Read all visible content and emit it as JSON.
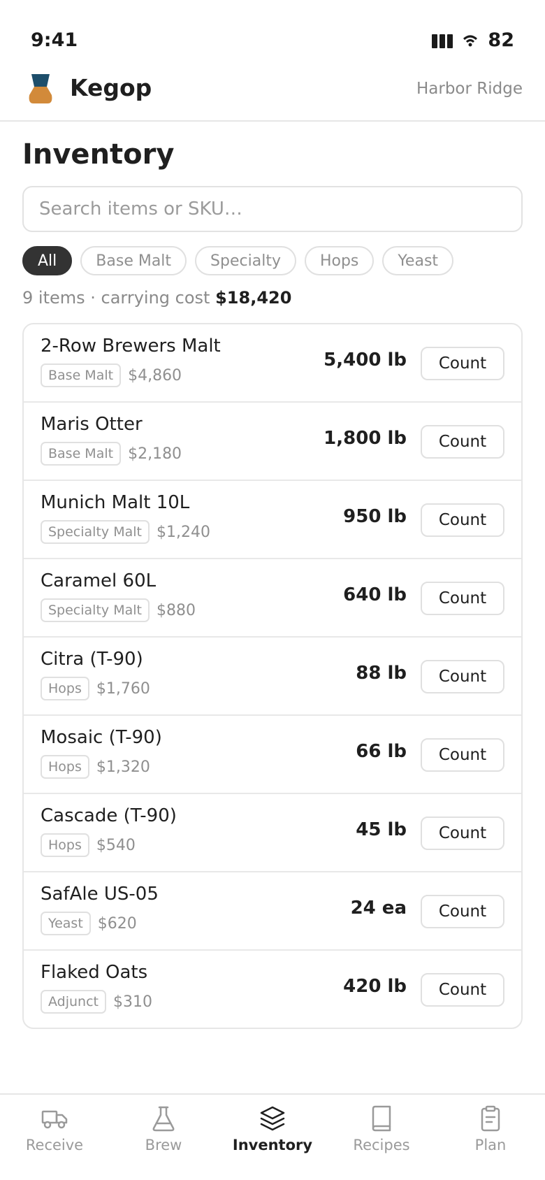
{
  "status_bar": {
    "time": "9:41",
    "battery": "82"
  },
  "header": {
    "app_name": "Kegop",
    "location": "Harbor Ridge"
  },
  "page": {
    "title": "Inventory"
  },
  "search": {
    "placeholder": "Search items or SKU…",
    "value": ""
  },
  "filters": [
    {
      "label": "All",
      "active": true
    },
    {
      "label": "Base Malt",
      "active": false
    },
    {
      "label": "Specialty",
      "active": false
    },
    {
      "label": "Hops",
      "active": false
    },
    {
      "label": "Yeast",
      "active": false
    }
  ],
  "summary": {
    "prefix": "9 items · carrying cost",
    "total": "$18,420"
  },
  "items": [
    {
      "name": "2-Row Brewers Malt",
      "category": "Base Malt",
      "cost": "$4,860",
      "qty": "5,400 lb",
      "action": "Count"
    },
    {
      "name": "Maris Otter",
      "category": "Base Malt",
      "cost": "$2,180",
      "qty": "1,800 lb",
      "action": "Count"
    },
    {
      "name": "Munich Malt 10L",
      "category": "Specialty Malt",
      "cost": "$1,240",
      "qty": "950 lb",
      "action": "Count"
    },
    {
      "name": "Caramel 60L",
      "category": "Specialty Malt",
      "cost": "$880",
      "qty": "640 lb",
      "action": "Count"
    },
    {
      "name": "Citra (T-90)",
      "category": "Hops",
      "cost": "$1,760",
      "qty": "88 lb",
      "action": "Count"
    },
    {
      "name": "Mosaic (T-90)",
      "category": "Hops",
      "cost": "$1,320",
      "qty": "66 lb",
      "action": "Count"
    },
    {
      "name": "Cascade (T-90)",
      "category": "Hops",
      "cost": "$540",
      "qty": "45 lb",
      "action": "Count"
    },
    {
      "name": "SafAle US-05",
      "category": "Yeast",
      "cost": "$620",
      "qty": "24 ea",
      "action": "Count"
    },
    {
      "name": "Flaked Oats",
      "category": "Adjunct",
      "cost": "$310",
      "qty": "420 lb",
      "action": "Count"
    }
  ],
  "tabs": [
    {
      "label": "Receive",
      "icon": "truck-icon",
      "active": false
    },
    {
      "label": "Brew",
      "icon": "flask-icon",
      "active": false
    },
    {
      "label": "Inventory",
      "icon": "layers-icon",
      "active": true
    },
    {
      "label": "Recipes",
      "icon": "book-icon",
      "active": false
    },
    {
      "label": "Plan",
      "icon": "clipboard-icon",
      "active": false
    }
  ],
  "colors": {
    "logo_dark": "#1d4e6b",
    "logo_amber": "#d28a3a",
    "chip_active": "#333333"
  }
}
